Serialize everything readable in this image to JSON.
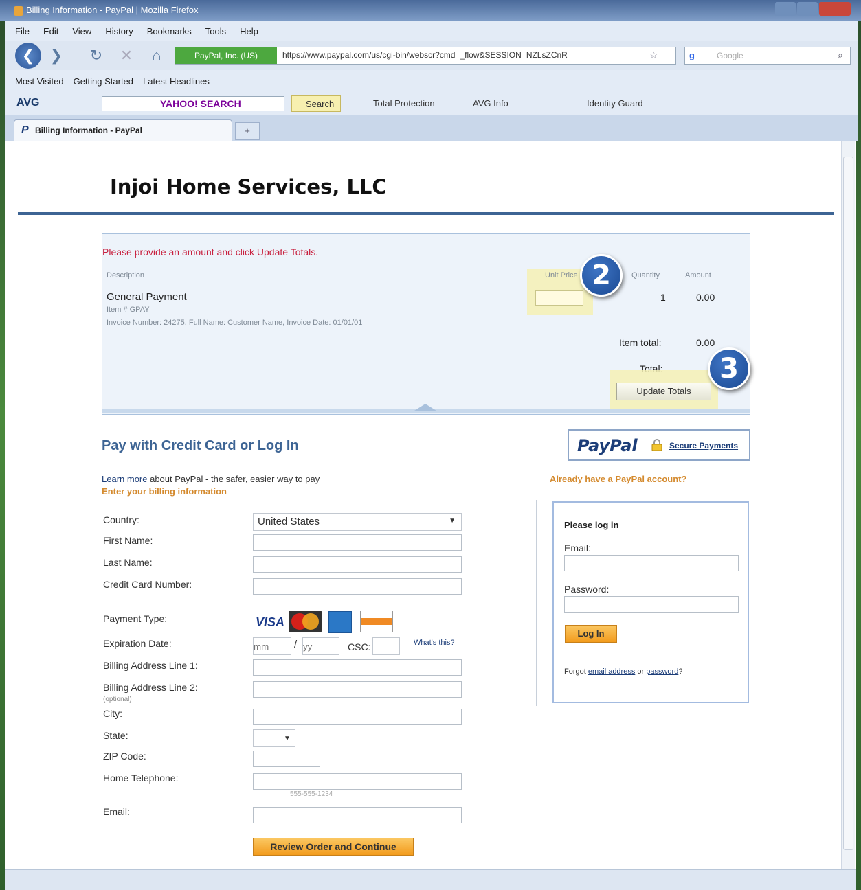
{
  "window": {
    "title": "Billing Information - PayPal | Mozilla Firefox"
  },
  "menu": [
    "File",
    "Edit",
    "View",
    "History",
    "Bookmarks",
    "Tools",
    "Help"
  ],
  "navbar": {
    "identity": "PayPal, Inc. (US)",
    "url": "https://www.paypal.com/us/cgi-bin/webscr?cmd=_flow&SESSION=NZLsZCnR",
    "search_placeholder": "Google"
  },
  "bookmarks": [
    "Most Visited",
    "Getting Started",
    "Latest Headlines"
  ],
  "toolbar": {
    "avg": "AVG",
    "yahoo": "YAHOO! SEARCH",
    "search_button": "Search",
    "total_protection": "Total Protection",
    "avg_info": "AVG Info",
    "identity_guard": "Identity Guard"
  },
  "tab": {
    "label": "Billing Information - PayPal"
  },
  "merchant": "Injoi Home Services, LLC",
  "cart": {
    "prompt": "Please provide an amount and click Update Totals.",
    "columns": {
      "description": "Description",
      "unit_price": "Unit Price",
      "quantity": "Quantity",
      "amount": "Amount"
    },
    "item": {
      "name": "General Payment",
      "item_number": "Item # GPAY",
      "invoice": "Invoice Number: 24275, Full Name: Customer Name, Invoice Date: 01/01/01",
      "quantity": "1",
      "amount": "0.00"
    },
    "item_total_label": "Item total:",
    "item_total_value": "0.00",
    "total_label": "Total:",
    "update_button": "Update Totals"
  },
  "callouts": {
    "step2": "2",
    "step3": "3"
  },
  "pay": {
    "title": "Pay with Credit Card or Log In",
    "paypal_logo": "PayPal",
    "secure_payments": "Secure Payments",
    "learn_more": "Learn more",
    "learn_more_rest": " about PayPal - the safer, easier way to pay",
    "enter_billing": "Enter your billing information",
    "already": "Already have a PayPal account?"
  },
  "form": {
    "country_label": "Country:",
    "country_value": "United States",
    "first_name_label": "First Name:",
    "last_name_label": "Last Name:",
    "card_number_label": "Credit Card Number:",
    "payment_type_label": "Payment Type:",
    "visa": "VISA",
    "expiration_label": "Expiration Date:",
    "exp_mm_placeholder": "mm",
    "exp_yy_placeholder": "yy",
    "exp_separator": "/",
    "csc_label": "CSC:",
    "whats_this": "What's this?",
    "address1_label": "Billing Address Line 1:",
    "address2_label": "Billing Address Line 2:",
    "optional": "(optional)",
    "city_label": "City:",
    "state_label": "State:",
    "zip_label": "ZIP Code:",
    "phone_label": "Home Telephone:",
    "phone_hint": "555-555-1234",
    "email_label": "Email:",
    "review_button": "Review Order and Continue"
  },
  "login": {
    "title": "Please log in",
    "email_label": "Email:",
    "password_label": "Password:",
    "login_button": "Log In",
    "forgot_prefix": "Forgot ",
    "forgot_email": "email address",
    "forgot_or": " or ",
    "forgot_password": "password",
    "forgot_suffix": "?"
  },
  "colors": {
    "accent_blue": "#3d6494",
    "prompt_red": "#c8213f",
    "orange_text": "#d48a2e",
    "button_orange": "#f29b1d",
    "highlight_yellow": "#f4f0b4"
  }
}
